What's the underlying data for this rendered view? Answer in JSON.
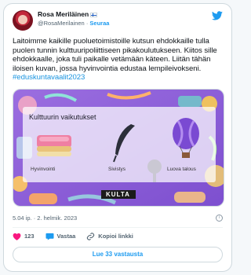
{
  "author": {
    "name": "Rosa Meriläinen",
    "handle": "@RosaMerilainen",
    "separator": "·",
    "follow_label": "Seuraa"
  },
  "tweet": {
    "text": "Laitoimme kaikille puoluetoimistoille kutsun ehdokkaille tulla puolen tunnin kulttuuripoliittiseen pikakoulutukseen. Kiitos sille ehdokkaalle, joka tuli paikalle vetämään käteen. Liitän tähän iloisen kuvan, jossa hyvinvointia edustaa lempileivokseni.",
    "hashtag": "#eduskuntavaalit2023"
  },
  "media": {
    "title": "Kulttuurin vaikutukset",
    "labels": [
      "Hyvinvointi",
      "Sivistys",
      "Luova talous"
    ],
    "logo": "KULTA"
  },
  "timestamp": {
    "time": "5.04 ip.",
    "separator": "·",
    "date": "2. helmik. 2023",
    "info": "i"
  },
  "actions": {
    "likes": "123",
    "reply_label": "Vastaa",
    "copy_label": "Kopioi linkki"
  },
  "more_replies_label": "Lue 33 vastausta",
  "colors": {
    "accent": "#1d9bf0",
    "like_red": "#f91880",
    "media_purple": "#8c5ad8"
  }
}
